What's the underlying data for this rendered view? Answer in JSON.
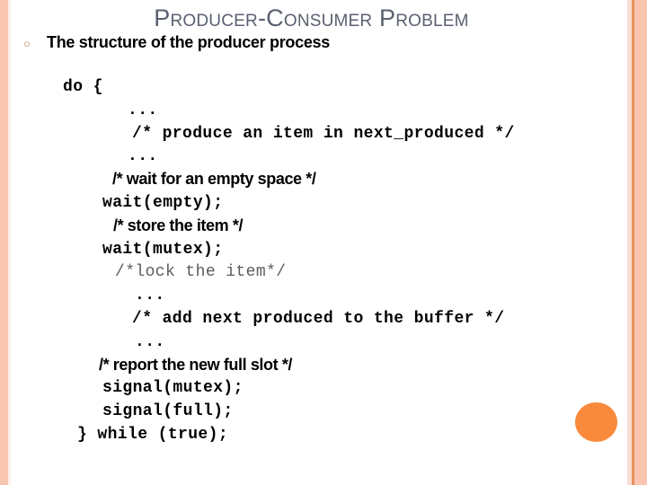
{
  "slide": {
    "title": "Producer-Consumer Problem",
    "accent_color": "#f98a3c",
    "stripe_color": "#f8c6b0",
    "title_color": "#5a6070"
  },
  "bullet": {
    "marker": "○",
    "text": "The structure of the producer process"
  },
  "code": {
    "lines": [
      {
        "text": "do {",
        "style": "mono",
        "indent": 0
      },
      {
        "text": "...",
        "style": "mono",
        "indent": 72
      },
      {
        "text": "/* produce an item in next_produced */",
        "style": "mono",
        "indent": 77
      },
      {
        "text": "...",
        "style": "mono",
        "indent": 72
      },
      {
        "text": "/* wait for an empty space */",
        "style": "sans",
        "indent": 55
      },
      {
        "text": "wait(empty);",
        "style": "mono",
        "indent": 44
      },
      {
        "text": "/* store the item */",
        "style": "sans",
        "indent": 56
      },
      {
        "text": "wait(mutex);",
        "style": "mono",
        "indent": 44
      },
      {
        "text": "/*lock the item*/",
        "style": "mono-faint",
        "indent": 58
      },
      {
        "text": "...",
        "style": "mono",
        "indent": 80
      },
      {
        "text": "/* add next produced to the buffer */",
        "style": "mono",
        "indent": 77
      },
      {
        "text": "...",
        "style": "mono",
        "indent": 80
      },
      {
        "text": "/* report the new full slot */",
        "style": "sans",
        "indent": 40
      },
      {
        "text": "signal(mutex);",
        "style": "mono",
        "indent": 44
      },
      {
        "text": "signal(full);",
        "style": "mono",
        "indent": 44
      },
      {
        "text": "} while (true);",
        "style": "mono",
        "indent": 16
      }
    ]
  }
}
